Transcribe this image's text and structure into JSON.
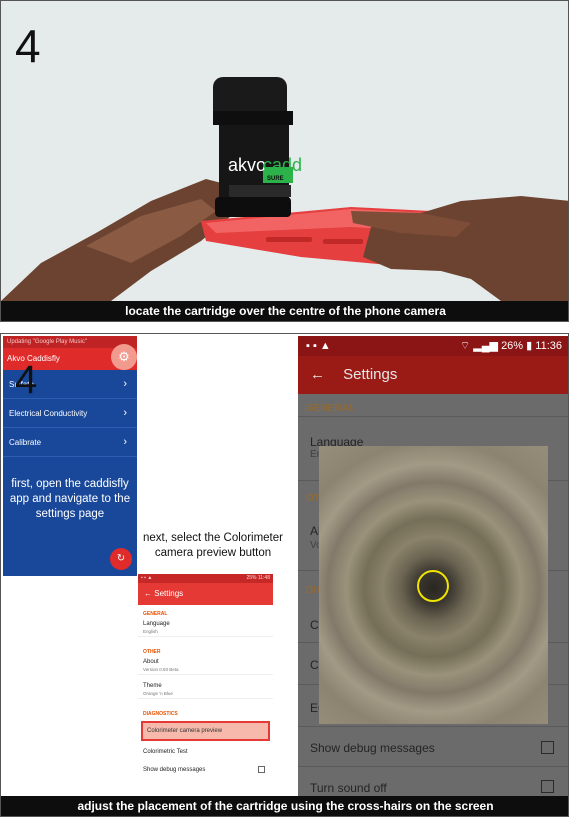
{
  "top_panel": {
    "step": "4",
    "product_label": "akvo",
    "product_label_accent": "cadd",
    "product_badge": "SURE",
    "caption": "locate the cartridge over the centre of the phone camera"
  },
  "bottom_panel": {
    "step": "4",
    "caption": "adjust the placement of the cartridge using the cross-hairs on the screen",
    "app_phone": {
      "status_text": "Updating \"Google Play Music\"",
      "app_title": "Akvo Caddisfly",
      "menu": [
        {
          "label": "Sulfate"
        },
        {
          "label": "Electrical Conductivity"
        },
        {
          "label": "Calibrate"
        }
      ],
      "instruction": "first, open the caddisfly app and navigate to the settings page"
    },
    "middle_label": "next, select the Colorimeter camera preview button",
    "settings_small": {
      "status_right": "25% 11:48",
      "title": "Settings",
      "general_header": "GENERAL",
      "language_title": "Language",
      "language_value": "English",
      "other_header": "OTHER",
      "about_title": "About",
      "about_value": "Version 0.93 Beta",
      "theme_title": "Theme",
      "theme_value": "Orange 'n Blue",
      "diagnostics_header": "DIAGNOSTICS",
      "highlight": "Colorimeter camera preview",
      "colorimetric_test": "Colorimetric Test",
      "show_debug": "Show debug messages"
    },
    "settings_big": {
      "status_battery": "26%",
      "status_time": "11:36",
      "title": "Settings",
      "general_header": "GENERAL",
      "language_title": "Language",
      "language_partial": "En",
      "other_partial": "OTH",
      "about_partial": "Al",
      "version_partial": "Vo",
      "diagnostics_partial": "DIA",
      "item_c1": "Co",
      "item_c2": "Co",
      "item_ec": "EC",
      "show_debug": "Show debug messages",
      "turn_sound": "Turn sound off"
    }
  }
}
